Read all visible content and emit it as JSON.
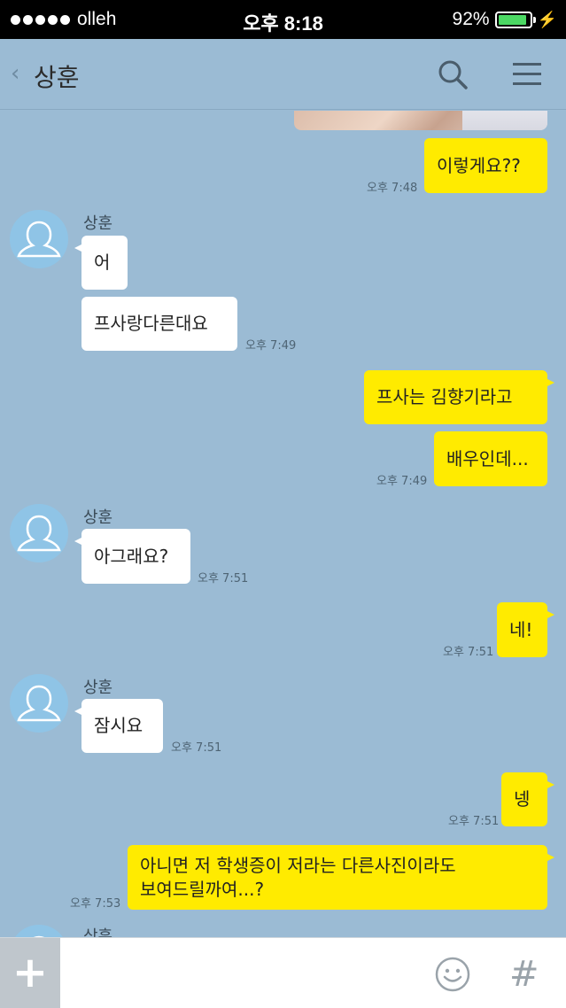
{
  "status_bar": {
    "carrier": "olleh",
    "time": "오후 8:18",
    "battery": "92%",
    "battery_level": 0.92,
    "battery_color": "#4cd964"
  },
  "header": {
    "title": "상훈",
    "back_icon": "chevron-left-icon",
    "search_icon": "search-icon",
    "menu_icon": "menu-icon"
  },
  "messages": {
    "m1": {
      "text": "이렇게요??",
      "time": "오후 7:48"
    },
    "sender1": "상훈",
    "m2": {
      "text": "어"
    },
    "m3": {
      "text": "프사랑다른대요",
      "time": "오후 7:49"
    },
    "m4": {
      "text": "프사는 김향기라고"
    },
    "m5": {
      "text": "배우인데...",
      "time": "오후 7:49"
    },
    "sender2": "상훈",
    "m6": {
      "text": "아그래요?",
      "time": "오후 7:51"
    },
    "m7": {
      "text": "네!",
      "time": "오후 7:51"
    },
    "sender3": "상훈",
    "m8": {
      "text": "잠시요",
      "time": "오후 7:51"
    },
    "m9": {
      "text": "넹",
      "time": "오후 7:51"
    },
    "m10": {
      "line1": "아니면 저 학생증이 저라는 다른사진이라도",
      "line2": "보여드릴까여...?",
      "time": "오후 7:53"
    },
    "sender4": "상훈"
  },
  "input_bar": {
    "plus": "+",
    "hash": "#",
    "emoji_icon": "smiley-icon"
  },
  "colors": {
    "background": "#9bbbd4",
    "my_bubble": "#ffeb00",
    "other_bubble": "#ffffff",
    "avatar": "#8fc4e6"
  }
}
